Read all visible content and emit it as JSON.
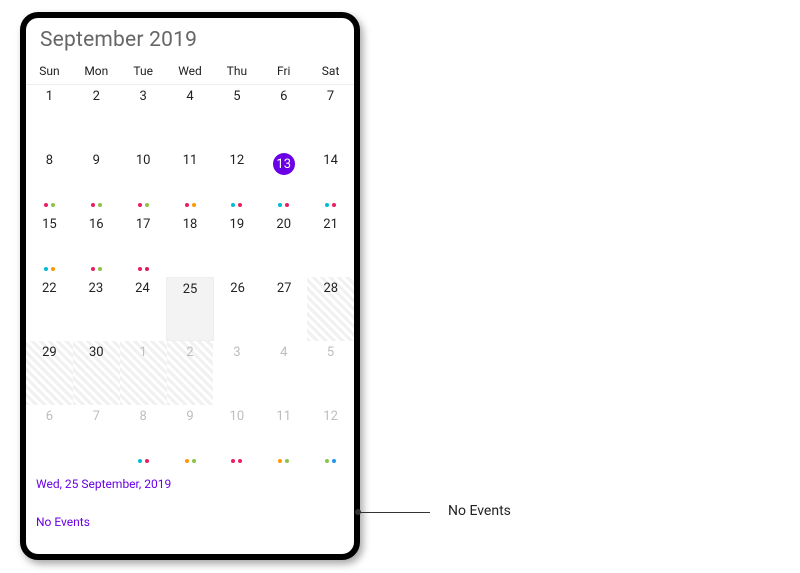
{
  "monthTitle": "September 2019",
  "weekdays": [
    "Sun",
    "Mon",
    "Tue",
    "Wed",
    "Thu",
    "Fri",
    "Sat"
  ],
  "selectedDay": 13,
  "agenda": {
    "dateLabel": "Wed, 25 September, 2019",
    "emptyLabel": "No Events"
  },
  "calloutLabel": "No Events",
  "colors": {
    "accent": "#6a00e6"
  },
  "rows": [
    [
      {
        "n": 1
      },
      {
        "n": 2
      },
      {
        "n": 3
      },
      {
        "n": 4
      },
      {
        "n": 5
      },
      {
        "n": 6
      },
      {
        "n": 7
      }
    ],
    [
      {
        "n": 8,
        "dots": [
          "pink",
          "green"
        ]
      },
      {
        "n": 9,
        "dots": [
          "pink",
          "green"
        ]
      },
      {
        "n": 10,
        "dots": [
          "pink",
          "green"
        ]
      },
      {
        "n": 11,
        "dots": [
          "pink",
          "orange"
        ]
      },
      {
        "n": 12,
        "dots": [
          "cyan",
          "pink"
        ]
      },
      {
        "n": 13,
        "dots": [
          "cyan",
          "pink"
        ],
        "selected": true
      },
      {
        "n": 14,
        "dots": [
          "cyan",
          "pink"
        ]
      }
    ],
    [
      {
        "n": 15,
        "dots": [
          "cyan",
          "orange"
        ]
      },
      {
        "n": 16,
        "dots": [
          "pink",
          "green"
        ]
      },
      {
        "n": 17,
        "dots": [
          "pink",
          "magenta"
        ]
      },
      {
        "n": 18
      },
      {
        "n": 19
      },
      {
        "n": 20
      },
      {
        "n": 21
      }
    ],
    [
      {
        "n": 22
      },
      {
        "n": 23
      },
      {
        "n": 24
      },
      {
        "n": 25,
        "shaded": true
      },
      {
        "n": 26
      },
      {
        "n": 27
      },
      {
        "n": 28,
        "hatched": true
      }
    ],
    [
      {
        "n": 29,
        "hatched": true
      },
      {
        "n": 30,
        "hatched": true
      },
      {
        "n": 1,
        "other": true,
        "hatched": true
      },
      {
        "n": 2,
        "other": true,
        "hatched": true
      },
      {
        "n": 3,
        "other": true
      },
      {
        "n": 4,
        "other": true
      },
      {
        "n": 5,
        "other": true
      }
    ],
    [
      {
        "n": 6,
        "other": true
      },
      {
        "n": 7,
        "other": true
      },
      {
        "n": 8,
        "other": true,
        "dots": [
          "cyan",
          "pink"
        ]
      },
      {
        "n": 9,
        "other": true,
        "dots": [
          "orange",
          "green"
        ]
      },
      {
        "n": 10,
        "other": true,
        "dots": [
          "pink",
          "pink"
        ]
      },
      {
        "n": 11,
        "other": true,
        "dots": [
          "orange",
          "green"
        ]
      },
      {
        "n": 12,
        "other": true,
        "dots": [
          "green",
          "blue"
        ]
      }
    ]
  ]
}
